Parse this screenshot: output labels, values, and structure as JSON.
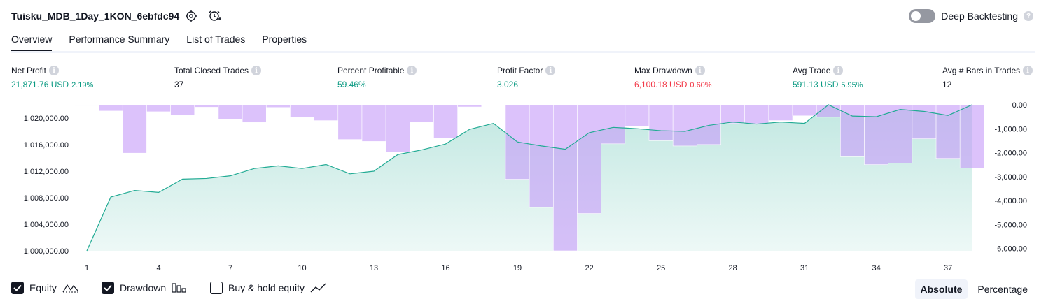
{
  "header": {
    "title": "Tuisku_MDB_1Day_1KON_6ebfdc94",
    "deep_backtesting_label": "Deep Backtesting",
    "help_mark": "?"
  },
  "tabs": [
    {
      "label": "Overview",
      "active": true
    },
    {
      "label": "Performance Summary",
      "active": false
    },
    {
      "label": "List of Trades",
      "active": false
    },
    {
      "label": "Properties",
      "active": false
    }
  ],
  "stats": {
    "net_profit": {
      "label": "Net Profit",
      "value": "21,871.76 USD",
      "sub": "2.19%"
    },
    "total_closed_trades": {
      "label": "Total Closed Trades",
      "value": "37"
    },
    "percent_profitable": {
      "label": "Percent Profitable",
      "value": "59.46%"
    },
    "profit_factor": {
      "label": "Profit Factor",
      "value": "3.026"
    },
    "max_drawdown": {
      "label": "Max Drawdown",
      "value": "6,100.18 USD",
      "sub": "0.60%"
    },
    "avg_trade": {
      "label": "Avg Trade",
      "value": "591.13 USD",
      "sub": "5.95%"
    },
    "avg_bars": {
      "label": "Avg # Bars in Trades",
      "value": "12"
    },
    "info_mark": "i"
  },
  "legend": {
    "equity": {
      "label": "Equity",
      "checked": true
    },
    "drawdown": {
      "label": "Drawdown",
      "checked": true
    },
    "buy_hold": {
      "label": "Buy & hold equity",
      "checked": false
    }
  },
  "modes": {
    "absolute": "Absolute",
    "percentage": "Percentage",
    "active": "absolute"
  },
  "colors": {
    "equity_line": "#22ab94",
    "drawdown_bar": "#c69cf8",
    "positive": "#089981",
    "negative": "#f23645"
  },
  "chart_data": {
    "type": "area",
    "x_ticks": [
      "1",
      "4",
      "7",
      "10",
      "13",
      "16",
      "19",
      "22",
      "25",
      "28",
      "31",
      "34",
      "37"
    ],
    "y_left_ticks": [
      "1,000,000.00",
      "1,004,000.00",
      "1,008,000.00",
      "1,012,000.00",
      "1,016,000.00",
      "1,020,000.00"
    ],
    "y_right_ticks": [
      "0.00",
      "-1,000.00",
      "-2,000.00",
      "-3,000.00",
      "-4,000.00",
      "-5,000.00",
      "-6,000.00"
    ],
    "y_left_range": [
      1000000,
      1022000
    ],
    "y_right_range": [
      -6100,
      0
    ],
    "x": [
      1,
      2,
      3,
      4,
      5,
      6,
      7,
      8,
      9,
      10,
      11,
      12,
      13,
      14,
      15,
      16,
      17,
      18,
      19,
      20,
      21,
      22,
      23,
      24,
      25,
      26,
      27,
      28,
      29,
      30,
      31,
      32,
      33,
      34,
      35,
      36,
      37,
      38
    ],
    "series": [
      {
        "name": "Equity",
        "values": [
          1000000,
          1008100,
          1009100,
          1008800,
          1010800,
          1010900,
          1011300,
          1012400,
          1012800,
          1012400,
          1013000,
          1011600,
          1012000,
          1014500,
          1015200,
          1016100,
          1018300,
          1019200,
          1016400,
          1015800,
          1015300,
          1017800,
          1018600,
          1018400,
          1018100,
          1018000,
          1018900,
          1019400,
          1019100,
          1019400,
          1019200,
          1022000,
          1020300,
          1020200,
          1021300,
          1021000,
          1020400,
          1022000
        ]
      },
      {
        "name": "Drawdown",
        "values": [
          -30,
          -260,
          -2020,
          -290,
          -440,
          -100,
          -620,
          -740,
          -110,
          -530,
          -660,
          -1450,
          -1530,
          -1980,
          -730,
          -1390,
          -90,
          0,
          -3110,
          -4290,
          -6100,
          -4540,
          -1630,
          -890,
          -1500,
          -1720,
          -1660,
          -780,
          -790,
          -660,
          -460,
          -520,
          -2170,
          -2500,
          -2440,
          -1420,
          -2240,
          -2640
        ]
      }
    ]
  }
}
